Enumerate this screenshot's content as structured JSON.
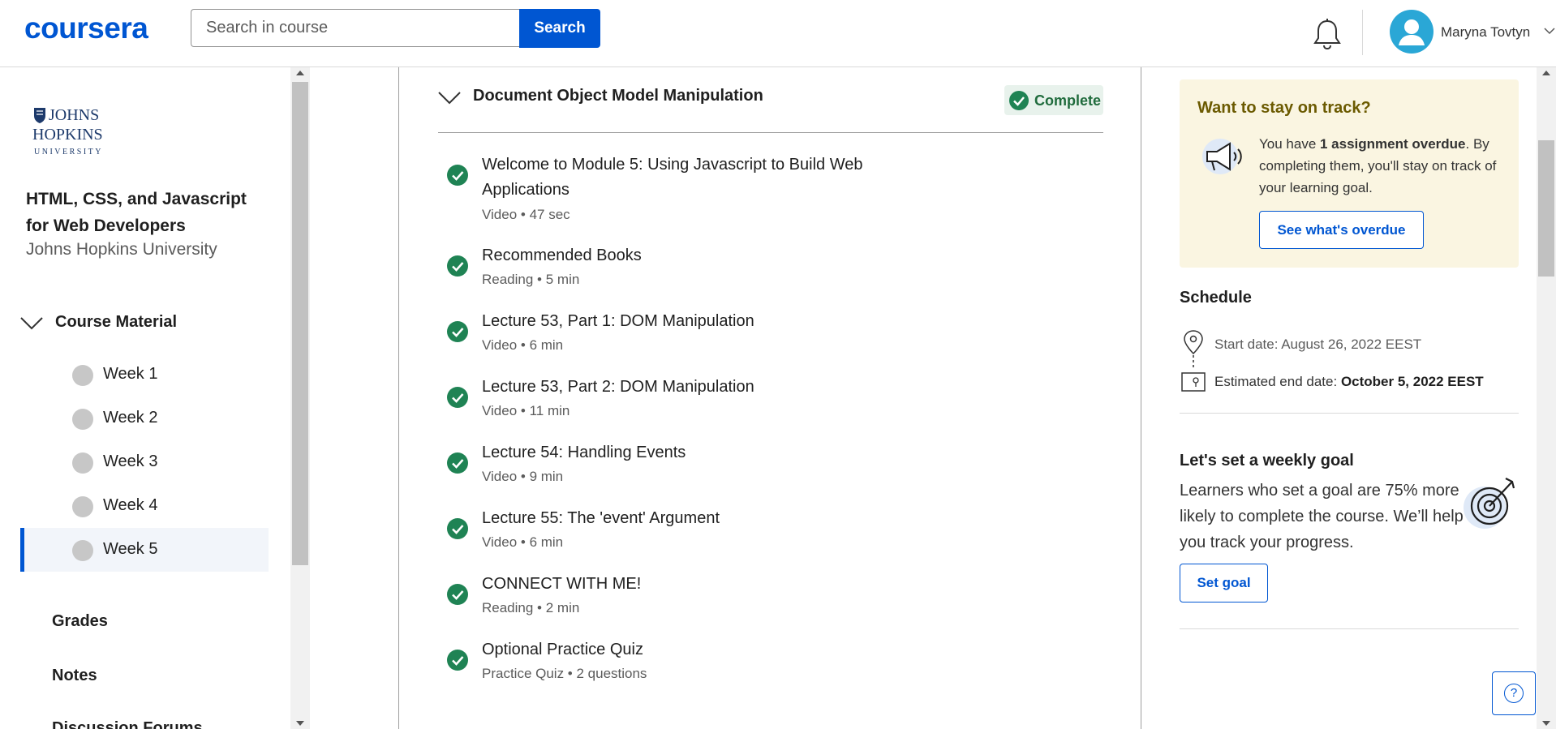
{
  "header": {
    "logo": "coursera",
    "search_placeholder": "Search in course",
    "search_button": "Search",
    "user_name": "Maryna Tovtyn"
  },
  "sidebar": {
    "course_title": "HTML, CSS, and Javascript for Web Developers",
    "university": "Johns Hopkins University",
    "logo_text": {
      "line1": "JOHNS",
      "line2": "HOPKINS",
      "line3": "UNIVERSITY"
    },
    "course_material_label": "Course Material",
    "weeks": [
      {
        "label": "Week 1",
        "active": false
      },
      {
        "label": "Week 2",
        "active": false
      },
      {
        "label": "Week 3",
        "active": false
      },
      {
        "label": "Week 4",
        "active": false
      },
      {
        "label": "Week 5",
        "active": true
      }
    ],
    "links": [
      "Grades",
      "Notes",
      "Discussion Forums"
    ]
  },
  "module": {
    "title": "Document Object Model Manipulation",
    "status": "Complete",
    "items": [
      {
        "title": "Welcome to Module 5: Using Javascript to Build Web Applications",
        "meta": "Video • 47 sec"
      },
      {
        "title": "Recommended Books",
        "meta": "Reading • 5 min"
      },
      {
        "title": "Lecture 53, Part 1: DOM Manipulation",
        "meta": "Video • 6 min"
      },
      {
        "title": "Lecture 53, Part 2: DOM Manipulation",
        "meta": "Video • 11 min"
      },
      {
        "title": "Lecture 54: Handling Events",
        "meta": "Video • 9 min"
      },
      {
        "title": "Lecture 55: The 'event' Argument",
        "meta": "Video • 6 min"
      },
      {
        "title": "CONNECT WITH ME!",
        "meta": "Reading • 2 min"
      },
      {
        "title": "Optional Practice Quiz",
        "meta": "Practice Quiz • 2 questions"
      }
    ]
  },
  "right_panel": {
    "on_track": {
      "title": "Want to stay on track?",
      "msg_prefix": "You have ",
      "msg_bold": "1 assignment overdue",
      "msg_suffix": ". By completing them, you'll stay on track of your learning goal.",
      "button": "See what's overdue"
    },
    "schedule": {
      "title": "Schedule",
      "start": "Start date: August 26, 2022 EEST",
      "end_label": "Estimated end date: ",
      "end_value": "October 5, 2022 EEST"
    },
    "goal": {
      "title": "Let's set a weekly goal",
      "text": "Learners who set a goal are 75% more likely to complete the course. We’ll help you track your progress.",
      "button": "Set goal"
    },
    "help_symbol": "?"
  },
  "colors": {
    "brand": "#0056d2",
    "complete_green": "#1f8354",
    "ontrack_bg": "#faf5e1"
  }
}
